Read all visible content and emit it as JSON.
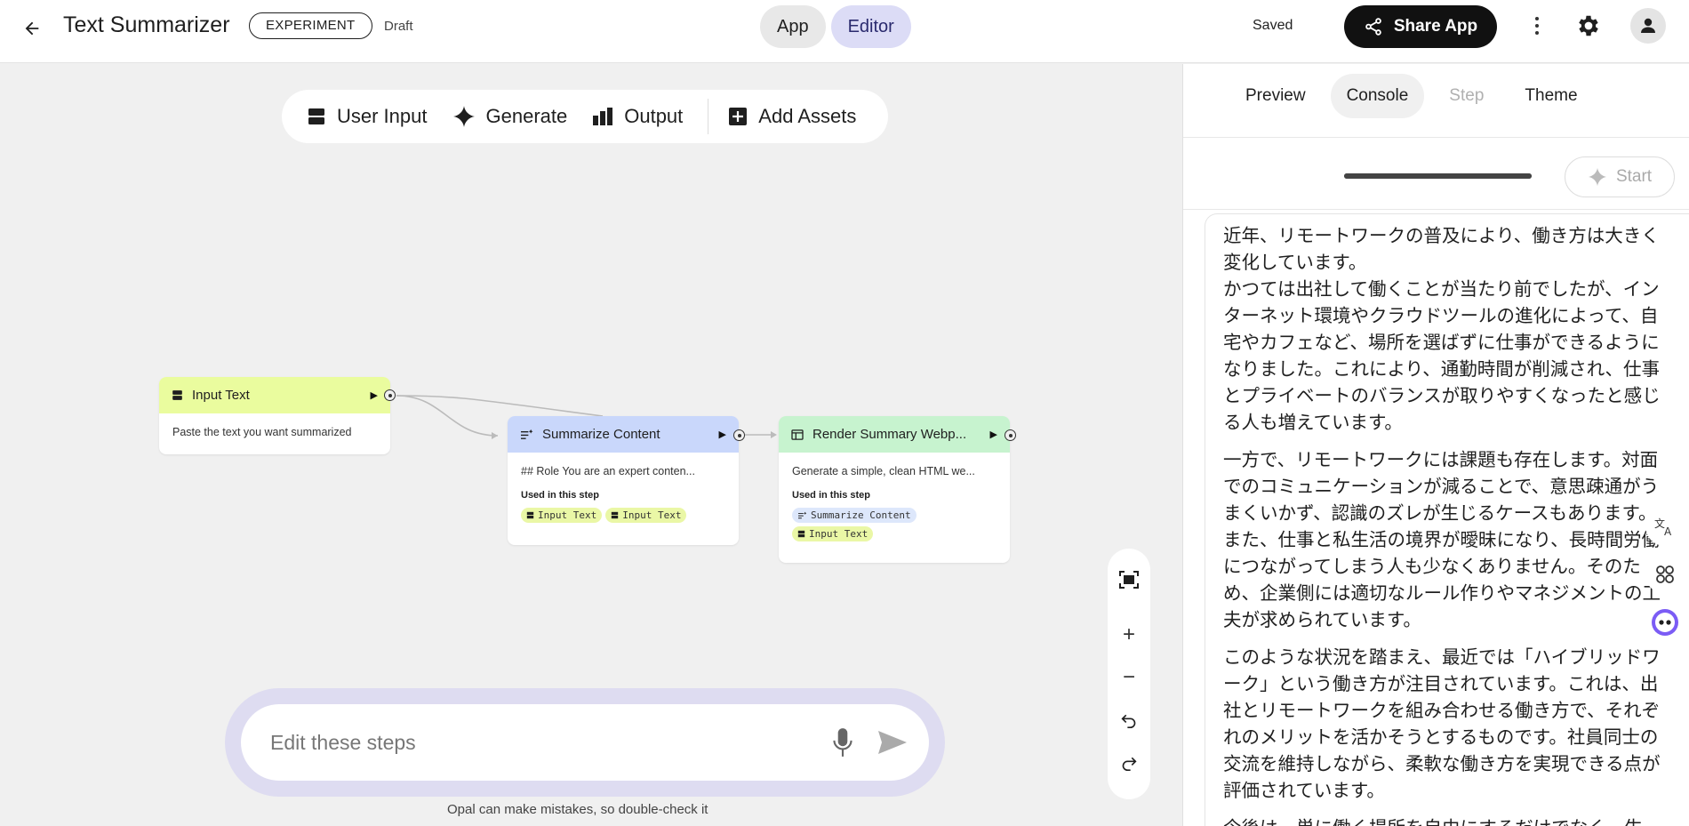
{
  "header": {
    "title": "Text Summarizer",
    "badge": "EXPERIMENT",
    "status": "Draft",
    "modes": [
      "App",
      "Editor"
    ],
    "active_mode": "Editor",
    "saved": "Saved",
    "share_label": "Share App"
  },
  "toolbar": {
    "items": [
      {
        "label": "User Input",
        "icon": "user-input-icon"
      },
      {
        "label": "Generate",
        "icon": "sparkle-icon"
      },
      {
        "label": "Output",
        "icon": "output-icon"
      },
      {
        "label": "Add Assets",
        "icon": "plus-box-icon"
      }
    ]
  },
  "nodes": {
    "input": {
      "title": "Input Text",
      "description": "Paste the text you want summarized",
      "color": "#eafc9e"
    },
    "summarize": {
      "title": "Summarize Content",
      "description": "## Role You are an expert conten...",
      "used_label": "Used in this step",
      "chips": [
        "Input Text",
        "Input Text"
      ],
      "color": "#c9d7fb"
    },
    "render": {
      "title": "Render Summary Webp...",
      "description": "Generate a simple, clean HTML we...",
      "used_label": "Used in this step",
      "chips": [
        "Summarize Content",
        "Input Text"
      ],
      "color": "#c7f3cf"
    }
  },
  "prompt": {
    "placeholder": "Edit these steps",
    "disclaimer": "Opal can make mistakes, so double-check it"
  },
  "panel": {
    "tabs": [
      "Preview",
      "Console",
      "Step",
      "Theme"
    ],
    "active_tab": "Console",
    "disabled_tab": "Step",
    "start_label": "Start",
    "output_paragraphs": [
      "近年、リモートワークの普及により、働き方は大きく変化しています。\nかつては出社して働くことが当たり前でしたが、インターネット環境やクラウドツールの進化によって、自宅やカフェなど、場所を選ばずに仕事ができるようになりました。これにより、通勤時間が削減され、仕事とプライベートのバランスが取りやすくなったと感じる人も増えています。",
      "一方で、リモートワークには課題も存在します。対面でのコミュニケーションが減ることで、意思疎通がうまくいかず、認識のズレが生じるケースもあります。また、仕事と私生活の境界が曖昧になり、長時間労働につながってしまう人も少なくありません。そのため、企業側には適切なルール作りやマネジメントの工夫が求められています。",
      "このような状況を踏まえ、最近では「ハイブリッドワーク」という働き方が注目されています。これは、出社とリモートワークを組み合わせる働き方で、それぞれのメリットを活かそうとするものです。社員同士の交流を維持しながら、柔軟な働き方を実現できる点が評価されています。",
      "今後は、単に働く場所を自由にするだけでなく、生"
    ]
  }
}
